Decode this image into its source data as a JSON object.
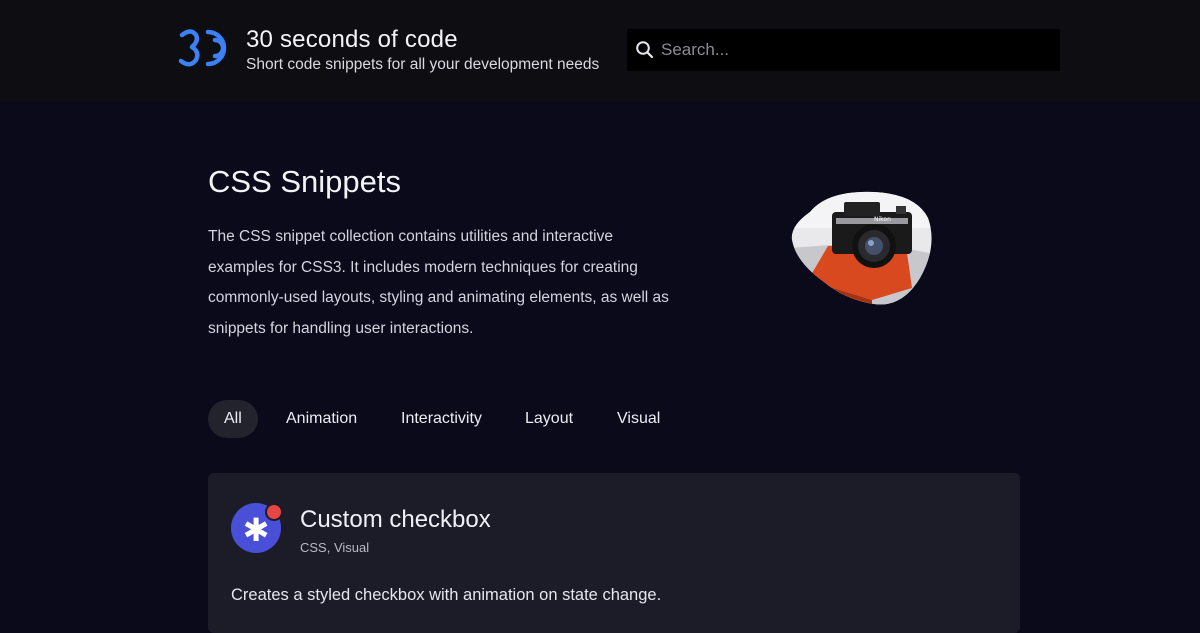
{
  "header": {
    "title": "30 seconds of code",
    "subtitle": "Short code snippets for all your development needs",
    "logo_icon": "30-seconds-logo-icon",
    "brand_color": "#3b82f6"
  },
  "search": {
    "placeholder": "Search...",
    "value": "",
    "icon": "search-icon"
  },
  "hero": {
    "title": "CSS Snippets",
    "description": "The CSS snippet collection contains utilities and interactive examples for CSS3. It includes modern techniques for creating commonly-used layouts, styling and animating elements, as well as snippets for handling user interactions.",
    "image_icon": "camera-photo-icon"
  },
  "filters": {
    "items": [
      {
        "label": "All",
        "active": true
      },
      {
        "label": "Animation",
        "active": false
      },
      {
        "label": "Interactivity",
        "active": false
      },
      {
        "label": "Layout",
        "active": false
      },
      {
        "label": "Visual",
        "active": false
      }
    ]
  },
  "snippets": [
    {
      "title": "Custom checkbox",
      "tags": "CSS, Visual",
      "description": "Creates a styled checkbox with animation on state change.",
      "icon": "asterisk-icon",
      "icon_color": "#4a4fd8",
      "badge_color": "#e84545"
    }
  ]
}
